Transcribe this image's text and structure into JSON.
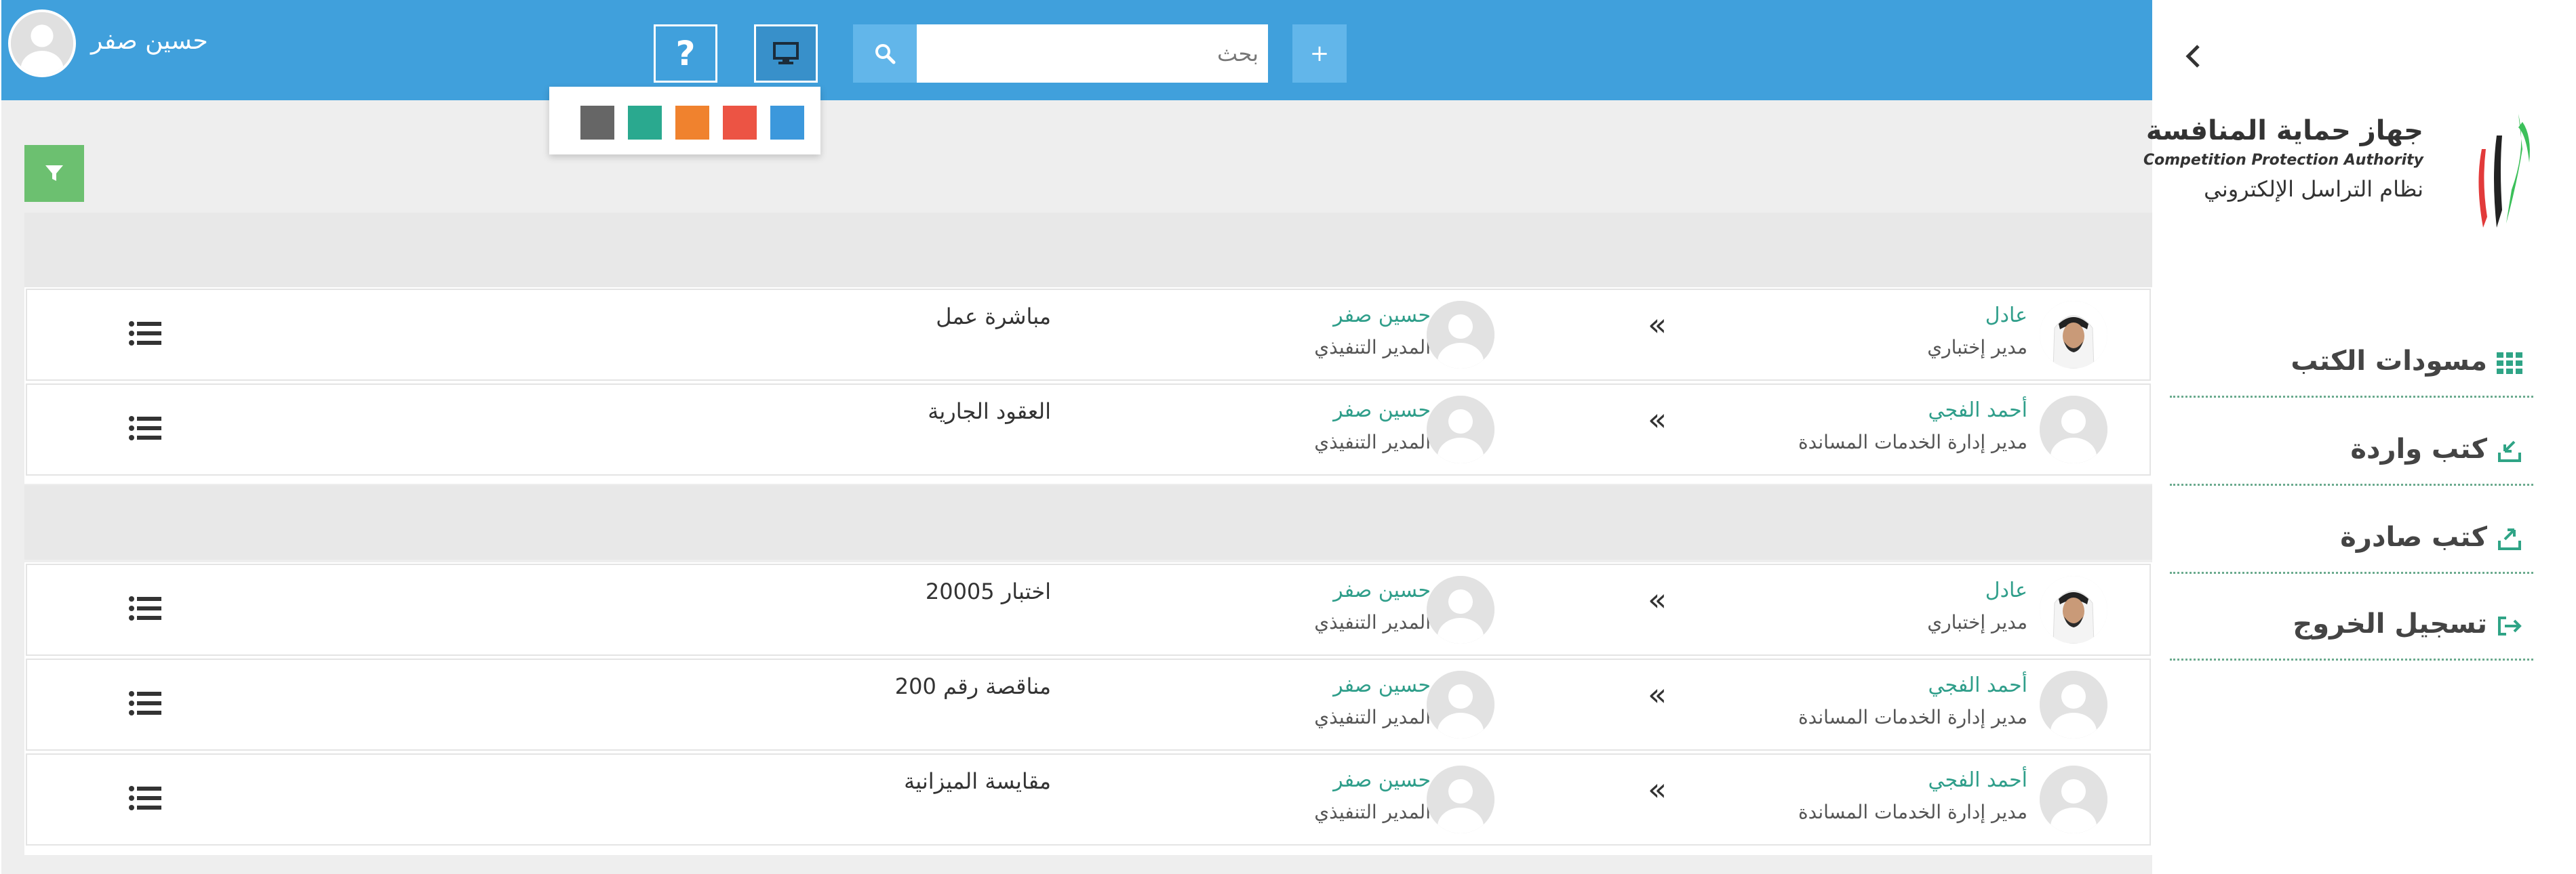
{
  "header": {
    "user_name": "حسين صفر",
    "search_placeholder": "بحث",
    "add_label": "+",
    "help_label": "?"
  },
  "theme_colors": [
    "#666666",
    "#2aa98f",
    "#f0822e",
    "#ec5444",
    "#3c98dc"
  ],
  "groups": [
    {
      "rows": [
        {
          "from_name": "عادل",
          "from_title": "مدير إختباري",
          "from_avatar": "photo",
          "to_name": "حسين صفر",
          "to_title": "المدير التنفيذي",
          "subject": "مباشرة عمل"
        },
        {
          "from_name": "أحمد الفجي",
          "from_title": "مدير إدارة الخدمات المساندة",
          "from_avatar": "placeholder",
          "to_name": "حسين صفر",
          "to_title": "المدير التنفيذي",
          "subject": "العقود الجارية"
        }
      ]
    },
    {
      "rows": [
        {
          "from_name": "عادل",
          "from_title": "مدير إختباري",
          "from_avatar": "photo",
          "to_name": "حسين صفر",
          "to_title": "المدير التنفيذي",
          "subject": "اختبار 20005"
        },
        {
          "from_name": "أحمد الفجي",
          "from_title": "مدير إدارة الخدمات المساندة",
          "from_avatar": "placeholder",
          "to_name": "حسين صفر",
          "to_title": "المدير التنفيذي",
          "subject": "مناقصة رقم 200"
        },
        {
          "from_name": "أحمد الفجي",
          "from_title": "مدير إدارة الخدمات المساندة",
          "from_avatar": "placeholder",
          "to_name": "حسين صفر",
          "to_title": "المدير التنفيذي",
          "subject": "مقايسة الميزانية"
        }
      ]
    }
  ],
  "sidebar": {
    "logo": {
      "arabic_name": "جهاز حماية المنافسة",
      "english_name": "Competition Protection Authority",
      "system_name": "نظام التراسل الإلكتروني"
    },
    "nav": [
      {
        "label": "مسودات الكتب",
        "icon": "grid-icon"
      },
      {
        "label": "كتب واردة",
        "icon": "inbox-download-icon"
      },
      {
        "label": "كتب صادرة",
        "icon": "outbox-upload-icon"
      },
      {
        "label": "تسجيل الخروج",
        "icon": "sign-out-icon"
      }
    ]
  }
}
